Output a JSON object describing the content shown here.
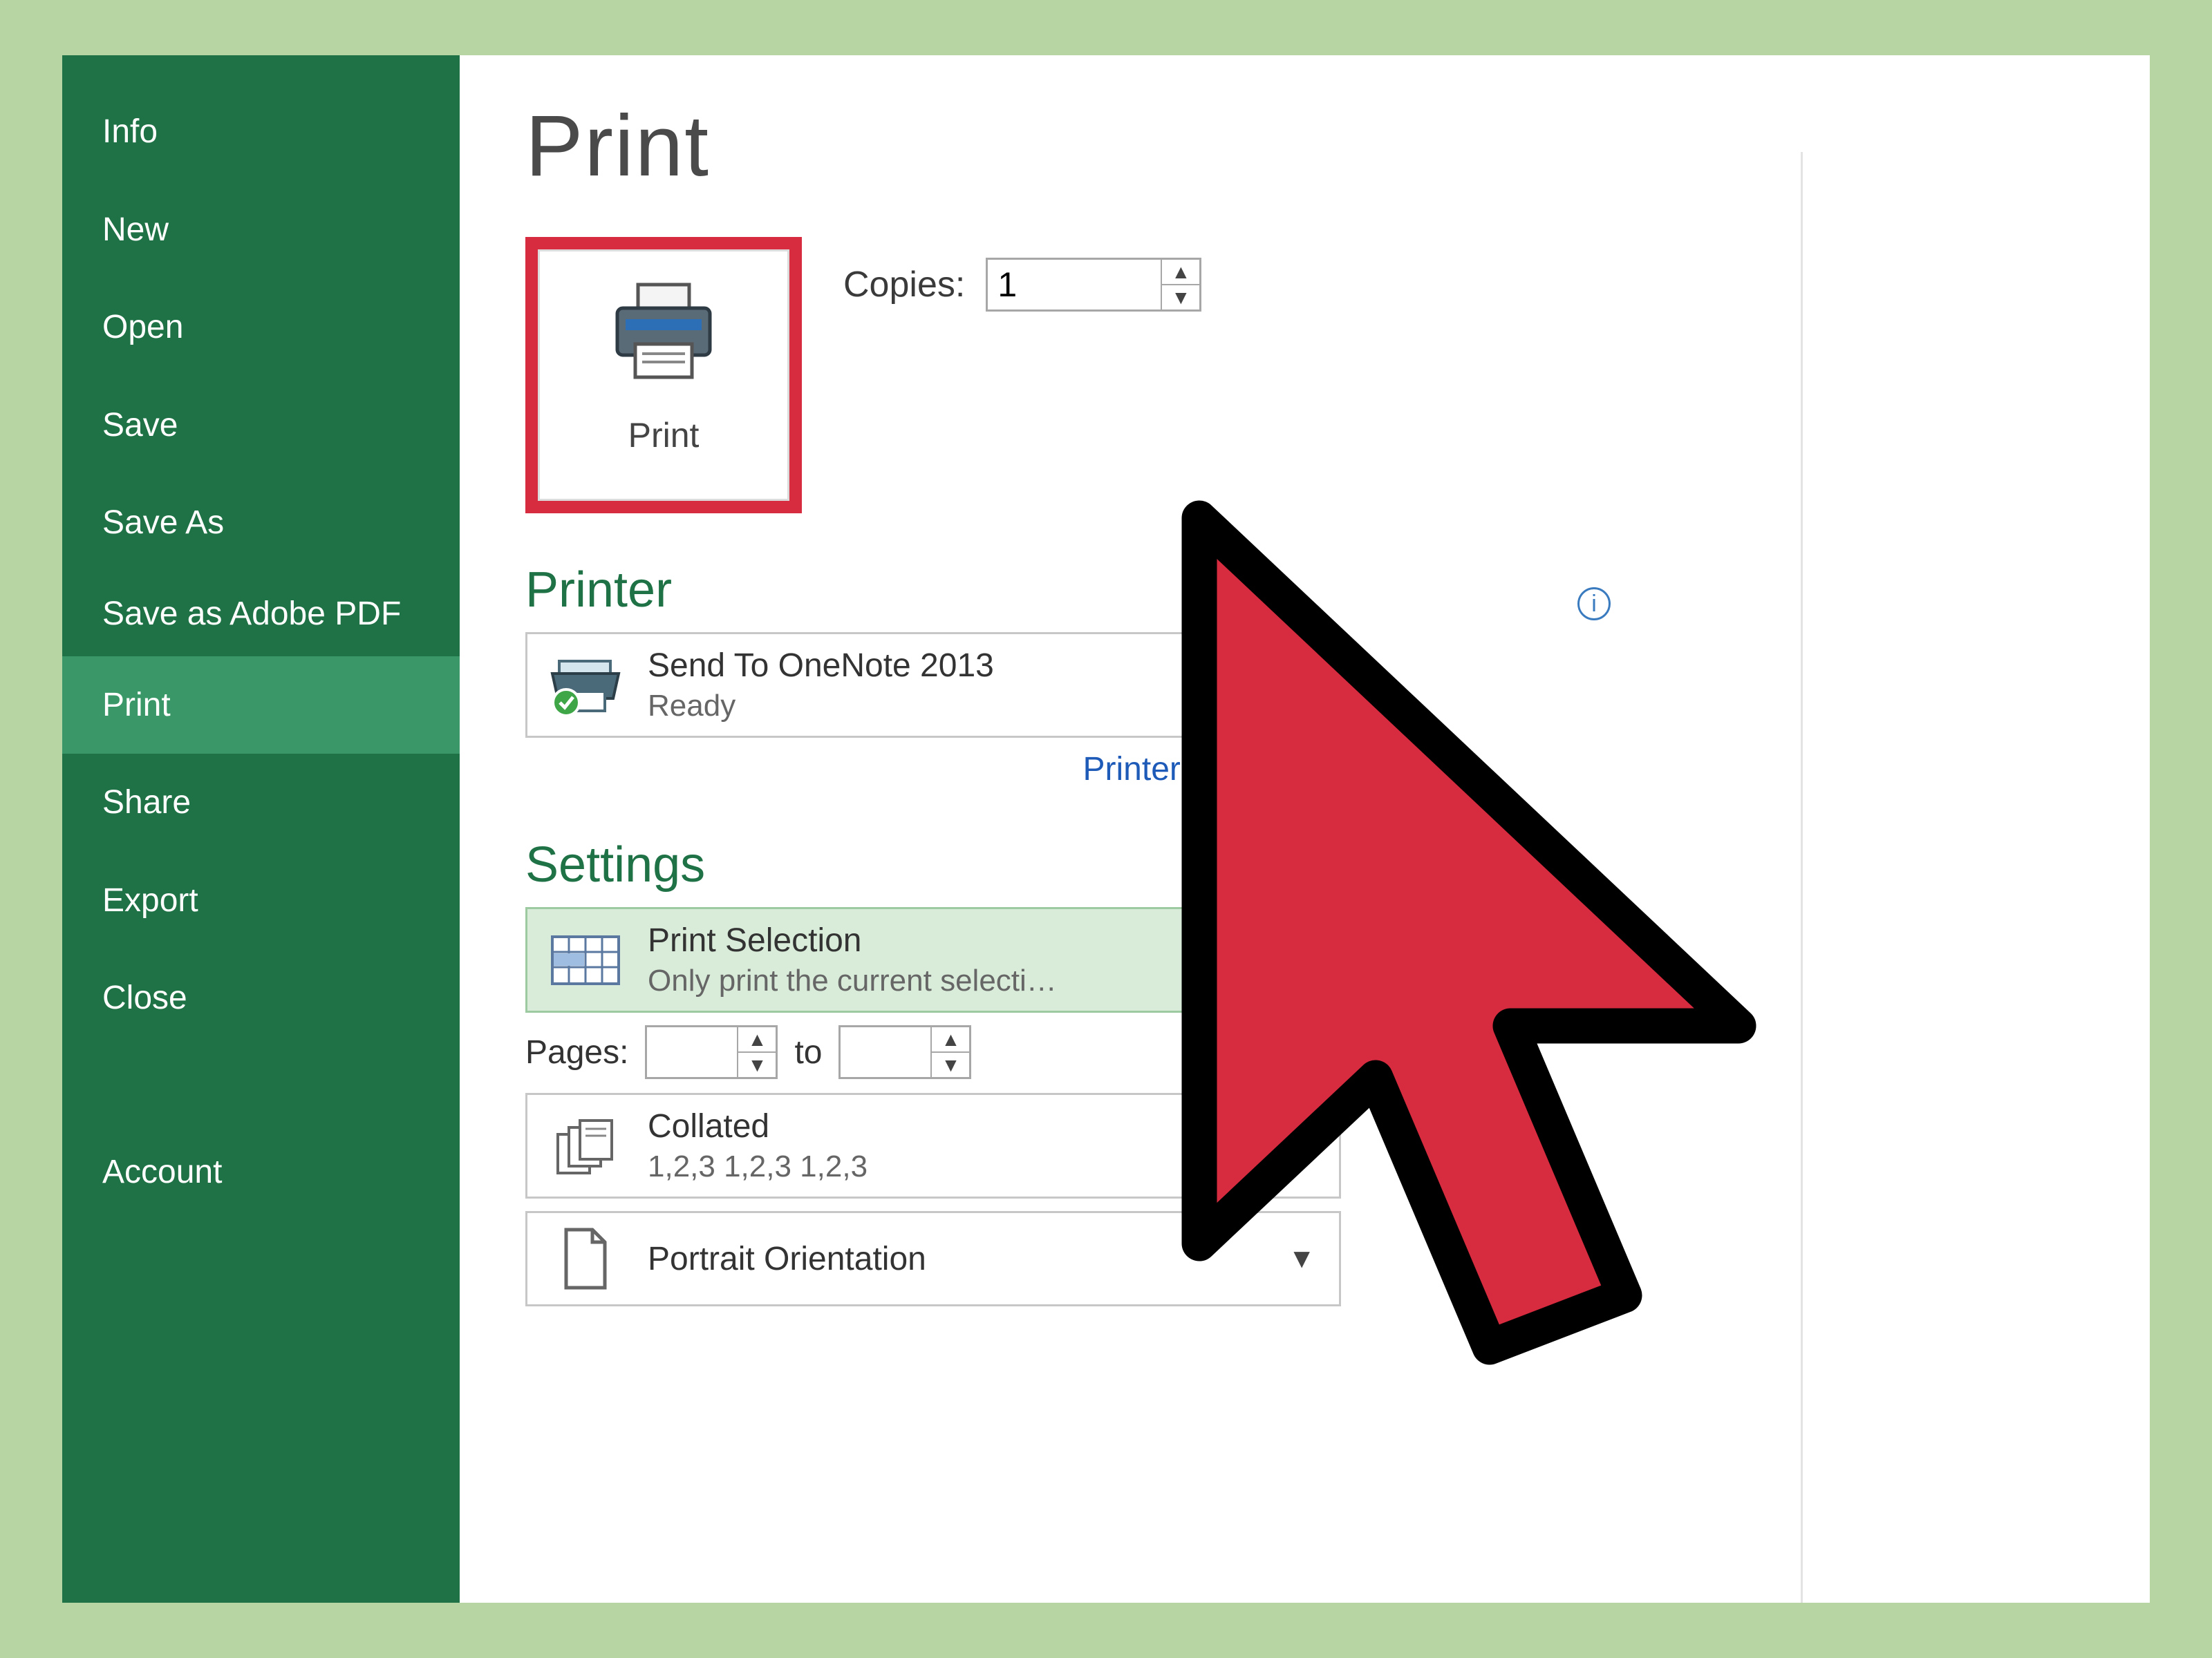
{
  "sidebar": {
    "items": [
      {
        "label": "Info"
      },
      {
        "label": "New"
      },
      {
        "label": "Open"
      },
      {
        "label": "Save"
      },
      {
        "label": "Save As"
      },
      {
        "label": "Save as Adobe PDF"
      },
      {
        "label": "Print"
      },
      {
        "label": "Share"
      },
      {
        "label": "Export"
      },
      {
        "label": "Close"
      },
      {
        "label": "Account"
      }
    ],
    "selected_index": 6
  },
  "page": {
    "title": "Print"
  },
  "print_button": {
    "label": "Print"
  },
  "copies": {
    "label": "Copies:",
    "value": "1"
  },
  "printer_section": {
    "header": "Printer",
    "selected": {
      "line1": "Send To OneNote 2013",
      "line2": "Ready"
    },
    "properties_link": "Printer Properties"
  },
  "settings_section": {
    "header": "Settings",
    "what_to_print": {
      "line1": "Print Selection",
      "line2": "Only print the current selecti…"
    },
    "pages": {
      "label": "Pages:",
      "from": "",
      "to_label": "to",
      "to": ""
    },
    "collation": {
      "line1": "Collated",
      "line2": "1,2,3   1,2,3   1,2,3"
    },
    "orientation": {
      "line1": "Portrait Orientation"
    }
  },
  "colors": {
    "accent_green": "#1f7246",
    "highlight_red": "#d72b3f",
    "link_blue": "#1e5bb8"
  }
}
